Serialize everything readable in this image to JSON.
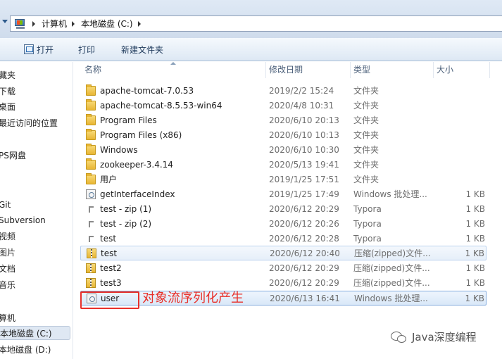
{
  "address_bar": {
    "crumbs": [
      "计算机",
      "本地磁盘 (C:)"
    ]
  },
  "toolbar": {
    "open_label": "打开",
    "print_label": "打印",
    "new_folder_label": "新建文件夹"
  },
  "nav_pane": {
    "items": [
      "藏夹",
      "下载",
      "桌面",
      "最近访问的位置",
      "PS网盘",
      "Git",
      "Subversion",
      "视频",
      "图片",
      "文档",
      "音乐",
      "算机",
      "本地磁盘 (C:)",
      "本地磁盘 (D:)"
    ],
    "selected": "本地磁盘 (C:)"
  },
  "columns": {
    "name": "名称",
    "modified": "修改日期",
    "type": "类型",
    "size": "大小"
  },
  "files": [
    {
      "name": "apache-tomcat-7.0.53",
      "date": "2019/2/2 15:24",
      "type": "文件夹",
      "size": "",
      "icon": "folder-icon"
    },
    {
      "name": "apache-tomcat-8.5.53-win64",
      "date": "2020/4/8 10:31",
      "type": "文件夹",
      "size": "",
      "icon": "folder-icon"
    },
    {
      "name": "Program Files",
      "date": "2020/6/10 20:13",
      "type": "文件夹",
      "size": "",
      "icon": "folder-icon"
    },
    {
      "name": "Program Files (x86)",
      "date": "2020/6/10 10:13",
      "type": "文件夹",
      "size": "",
      "icon": "folder-icon"
    },
    {
      "name": "Windows",
      "date": "2020/6/10 10:30",
      "type": "文件夹",
      "size": "",
      "icon": "folder-icon"
    },
    {
      "name": "zookeeper-3.4.14",
      "date": "2020/5/13 19:41",
      "type": "文件夹",
      "size": "",
      "icon": "folder-icon"
    },
    {
      "name": "用户",
      "date": "2019/1/25 17:51",
      "type": "文件夹",
      "size": "",
      "icon": "folder-icon"
    },
    {
      "name": "getInterfaceIndex",
      "date": "2019/1/25 17:49",
      "type": "Windows 批处理...",
      "size": "1 KB",
      "icon": "batch-file-icon"
    },
    {
      "name": "test - zip (1)",
      "date": "2020/6/12 20:29",
      "type": "Typora",
      "size": "1 KB",
      "icon": "typora-file-icon"
    },
    {
      "name": "test - zip (2)",
      "date": "2020/6/12 20:26",
      "type": "Typora",
      "size": "1 KB",
      "icon": "typora-file-icon"
    },
    {
      "name": "test",
      "date": "2020/6/12 20:28",
      "type": "Typora",
      "size": "1 KB",
      "icon": "typora-file-icon"
    },
    {
      "name": "test",
      "date": "2020/6/12 20:40",
      "type": "压缩(zipped)文件...",
      "size": "1 KB",
      "icon": "zip-file-icon"
    },
    {
      "name": "test2",
      "date": "2020/6/12 20:29",
      "type": "压缩(zipped)文件...",
      "size": "1 KB",
      "icon": "zip-file-icon"
    },
    {
      "name": "test3",
      "date": "2020/6/12 20:29",
      "type": "压缩(zipped)文件...",
      "size": "1 KB",
      "icon": "zip-file-icon"
    },
    {
      "name": "user",
      "date": "2020/6/13 16:41",
      "type": "Windows 批处理...",
      "size": "1 KB",
      "icon": "batch-file-icon"
    }
  ],
  "annotation": {
    "text": "对象流序列化产生",
    "color": "#e8302a"
  },
  "watermark": {
    "text": "Java深度编程"
  }
}
